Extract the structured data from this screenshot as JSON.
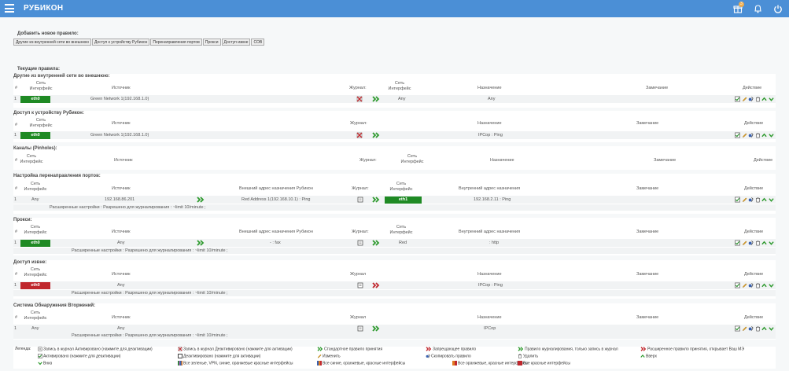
{
  "app": {
    "title": "РУБИКОН",
    "gift_count": "3"
  },
  "add": {
    "title": "Добавить новое правило:",
    "buttons": [
      "Другие из внутренней сети во внешнюю",
      "Доступ к устройству Рубикон",
      "Перенаправления портов",
      "Прокси",
      "Доступ извне",
      "СОВ"
    ]
  },
  "current": {
    "title": "Текущие правила:"
  },
  "hdr": {
    "num": "#",
    "iface_net": "Сеть",
    "iface_if": "Интерфейс",
    "source": "Источник",
    "journal": "Журнал",
    "journal_colon": "Журнал:",
    "dest": "Назначение",
    "note": "Замечание",
    "action": "Действие",
    "ext_dst": "Внешний адрес назначения Рубикон",
    "int_dst": "Внутренний адрес назначения"
  },
  "s1": {
    "title": "Другие из внутренней сети во внешнюю:",
    "num": "1",
    "iface": "eth0",
    "source": "Green Network 1(192.168.1.0)",
    "net": "Any",
    "dest": "Any"
  },
  "s2": {
    "title": "Доступ к устройству Рубикон:",
    "num": "1",
    "iface": "eth0",
    "source": "Green Network 1(192.168.1.0)",
    "dest": "IPCop : Ping"
  },
  "s3": {
    "title": "Каналы (Pinholes):"
  },
  "s4": {
    "title": "Настройка перенаправления портов:",
    "num": "1",
    "any": "Any",
    "source": "192.168.86.201",
    "ext": "Red Address 1(192.168.10.1) : Ping",
    "iface": "eth1",
    "int": "192.168.2.11 : Ping",
    "ext_text": "Расширенные настройки :  Разрешено для журналирования : ~limit 10/minute ;"
  },
  "s5": {
    "title": "Прокси:",
    "num": "1",
    "iface": "eth0",
    "source": "Any",
    "ext": "- : fax",
    "net": "Red",
    "int": ": http",
    "ext_text": "Расширенные настройки :  Разрешено для журналирования : ~limit 10/minute ;"
  },
  "s6": {
    "title": "Доступ извне:",
    "num": "1",
    "iface": "eth0",
    "source": "Any",
    "dest": "IPCop : Ping",
    "ext_text": "Расширенные настройки :  Разрешено для журналирования : ~limit 10/minute ;"
  },
  "s7": {
    "title": "Система Обнаружения Вторжений:",
    "num": "1",
    "any": "Any",
    "source": "Any",
    "dest": "IPCop",
    "ext_text": "Расширенные настройки :  Разрешено для журналирования : ~limit 10/minute ;"
  },
  "legend": {
    "title": "Легенда:",
    "l1": "Запись в журнал Активировано (нажмите для деактивации)",
    "l2": "Запись в журнал Деактивировано (нажмите для активации)",
    "l3": "Стандартное правило принятия",
    "l4": "Запрещающее правило",
    "l5": "Правило журналирования, только запись в журнал",
    "l6": "Расширенное правило принятия, открывает Ваш МЭ",
    "l7": "Активировано (нажмите для деактивации)",
    "l8": "Деактивировано (нажмите для активации)",
    "l9": "Изменить",
    "l10": "Скопировать правило",
    "l11": "Удалить",
    "l12": "Вверх",
    "l13": "Вниз",
    "l14": "Все зеленые, VPN, синие, оранжевые красные интерфейсы",
    "l15": "Все синие, оранжевые, красные интерфейсы",
    "l16": "Все оранжевые, красные интерфейсы",
    "l17": "Все красные интерфейсы"
  },
  "colors": {
    "topbar": "#4b8fd6",
    "green_iface": "#1f8a24",
    "red_iface": "#c0272d",
    "accept_arrow": "#2e9a2e",
    "deny_arrow": "#c0272d"
  }
}
